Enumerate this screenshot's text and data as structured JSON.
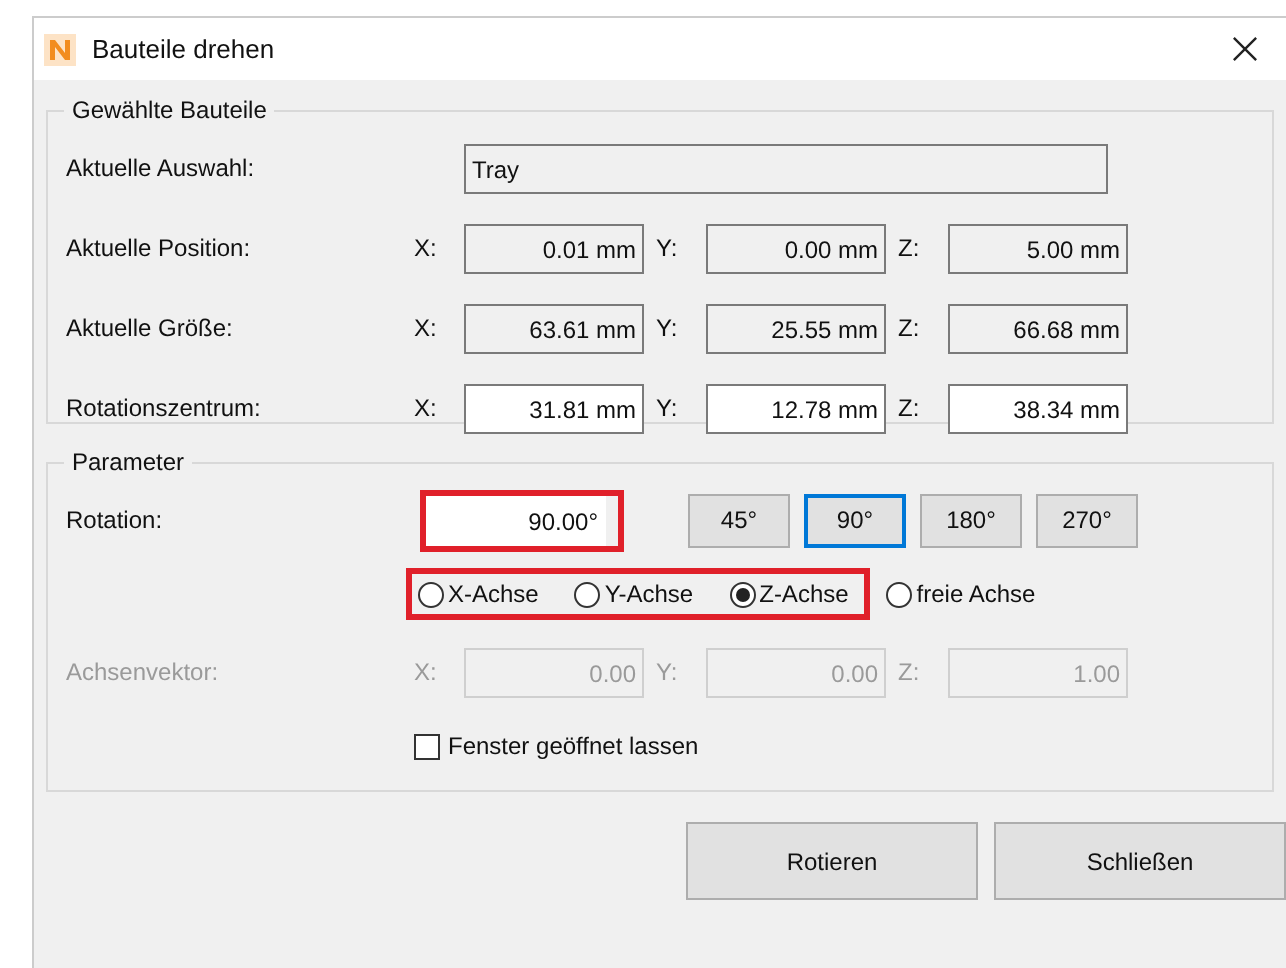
{
  "window": {
    "title": "Bauteile drehen"
  },
  "selected_parts": {
    "title": "Gewählte Bauteile",
    "selection": {
      "label": "Aktuelle Auswahl:",
      "value": "Tray"
    },
    "rows": [
      {
        "label": "Aktuelle Position:",
        "editable": false,
        "fields": [
          {
            "axis": "X:",
            "value": "0.01 mm"
          },
          {
            "axis": "Y:",
            "value": "0.00 mm"
          },
          {
            "axis": "Z:",
            "value": "5.00 mm"
          }
        ]
      },
      {
        "label": "Aktuelle Größe:",
        "editable": false,
        "fields": [
          {
            "axis": "X:",
            "value": "63.61 mm"
          },
          {
            "axis": "Y:",
            "value": "25.55 mm"
          },
          {
            "axis": "Z:",
            "value": "66.68 mm"
          }
        ]
      },
      {
        "label": "Rotationszentrum:",
        "editable": true,
        "fields": [
          {
            "axis": "X:",
            "value": "31.81 mm"
          },
          {
            "axis": "Y:",
            "value": "12.78 mm"
          },
          {
            "axis": "Z:",
            "value": "38.34 mm"
          }
        ]
      }
    ]
  },
  "parameters": {
    "title": "Parameter",
    "rotation": {
      "label": "Rotation:",
      "value": "90.00°",
      "highlighted": true
    },
    "presets": [
      {
        "label": "45°",
        "selected": false
      },
      {
        "label": "90°",
        "selected": true
      },
      {
        "label": "180°",
        "selected": false
      },
      {
        "label": "270°",
        "selected": false
      }
    ],
    "axes_highlighted": true,
    "axes": [
      {
        "label": "X-Achse",
        "selected": false
      },
      {
        "label": "Y-Achse",
        "selected": false
      },
      {
        "label": "Z-Achse",
        "selected": true
      }
    ],
    "free_axis": {
      "label": "freie Achse",
      "selected": false
    },
    "axis_vector": {
      "label": "Achsenvektor:",
      "disabled": true,
      "fields": [
        {
          "axis": "X:",
          "value": "0.00"
        },
        {
          "axis": "Y:",
          "value": "0.00"
        },
        {
          "axis": "Z:",
          "value": "1.00"
        }
      ]
    },
    "keep_open": {
      "label": "Fenster geöffnet lassen",
      "checked": false
    }
  },
  "buttons": [
    "Rotieren",
    "Schließen"
  ]
}
